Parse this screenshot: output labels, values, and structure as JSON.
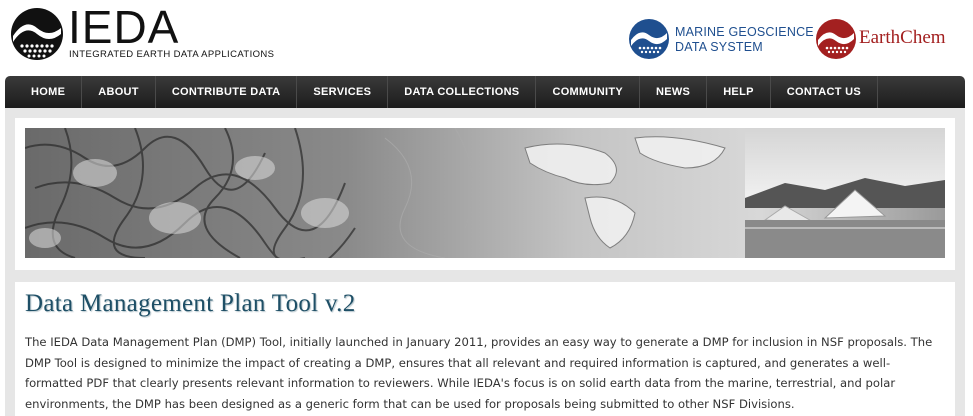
{
  "header": {
    "logo_name": "IEDA",
    "logo_subtitle": "INTEGRATED EARTH DATA APPLICATIONS",
    "partners": [
      {
        "line1": "MARINE GEOSCIENCE",
        "line2": "DATA SYSTEM",
        "color": "#1f4f8f",
        "icon": "mgds-logo-icon"
      },
      {
        "name": "EarthChem",
        "color": "#a32020",
        "icon": "earthchem-logo-icon"
      }
    ]
  },
  "nav": {
    "items": [
      "HOME",
      "ABOUT",
      "CONTRIBUTE DATA",
      "SERVICES",
      "DATA COLLECTIONS",
      "COMMUNITY",
      "NEWS",
      "HELP",
      "CONTACT US"
    ]
  },
  "banner": {
    "icon": "earth-imagery-banner"
  },
  "main": {
    "title": "Data Management Plan Tool v.2",
    "intro": "The IEDA Data Management Plan (DMP) Tool, initially launched in January 2011, provides an easy way to generate a DMP for inclusion in NSF proposals. The DMP Tool is designed to minimize the impact of creating a DMP, ensures that all relevant and required information is captured, and generates a well-formatted PDF that clearly presents relevant information to reviewers. While IEDA's focus is on solid earth data from the marine, terrestrial, and polar environments, the DMP has been designed as a generic form that can be used for proposals being submitted to other NSF Divisions."
  },
  "colors": {
    "title": "#1e4f66",
    "nav_bg": "#2a2a2a",
    "content_bg": "#e6e6e6"
  }
}
